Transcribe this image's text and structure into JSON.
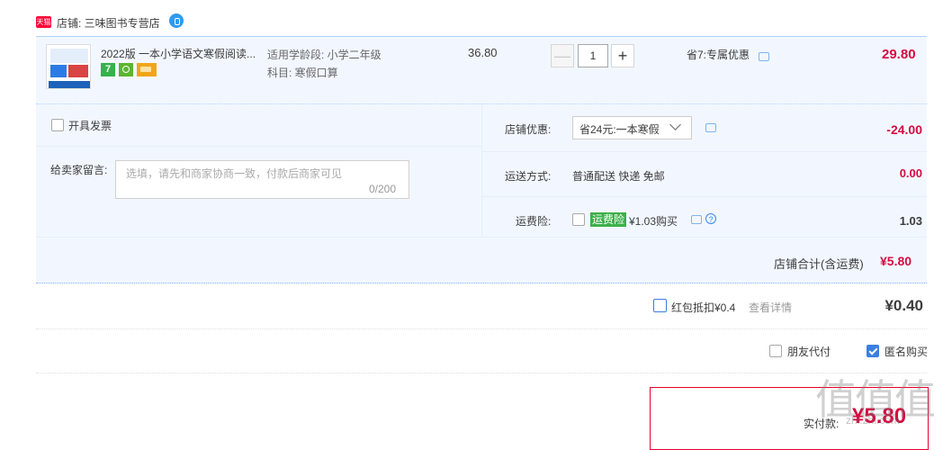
{
  "shop": {
    "tag": "天猫",
    "name": "店铺: 三味图书专营店"
  },
  "item": {
    "title": "2022版 一本小学语文寒假阅读...",
    "attr_grade": "适用学龄段: 小学二年级",
    "attr_subject": "科目: 寒假口算",
    "price": "36.80",
    "quantity": "1",
    "minus": "—",
    "plus": "+",
    "discount": "省7:专属优惠",
    "total": "29.80",
    "badge_number": "7"
  },
  "options": {
    "invoice_label": "开具发票",
    "message_label": "给卖家留言:",
    "message_placeholder": "选填，请先和商家协商一致，付款后商家可见",
    "message_count": "0/200",
    "shop_discount_label": "店铺优惠:",
    "shop_discount_value": "省24元:一本寒假",
    "shop_discount_amount": "-24.00",
    "shipping_label": "运送方式:",
    "shipping_value": "普通配送 快递 免邮",
    "shipping_amount": "0.00",
    "insurance_label": "运费险:",
    "insurance_tag": "运费险",
    "insurance_price": "¥1.03购买",
    "insurance_amount": "1.03",
    "question_mark": "?",
    "shop_total_label": "店铺合计(含运费)",
    "shop_total_value": "¥5.80"
  },
  "redpacket": {
    "label": "红包抵扣¥0.4",
    "link": "查看详情",
    "amount": "¥0.40"
  },
  "extras": {
    "friend_pay": "朋友代付",
    "anonymous": "匿名购买"
  },
  "submit": {
    "label": "实付款:",
    "amount": "¥5.80"
  },
  "watermark": {
    "text": "值值值",
    "url": "zhi.zhi.com"
  },
  "colors": {
    "accent": "#d70a3f",
    "panel": "#f2f7ff",
    "border": "#b2d1ff"
  }
}
